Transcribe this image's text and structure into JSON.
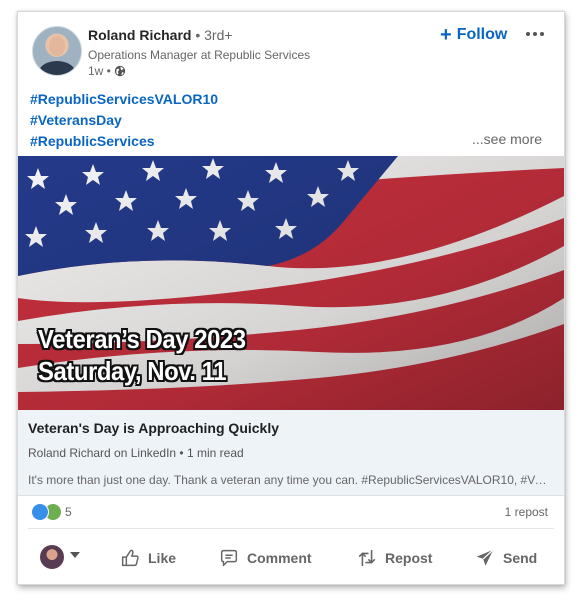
{
  "post": {
    "author": {
      "name": "Roland Richard",
      "degree": "• 3rd+",
      "headline": "Operations Manager at Republic Services",
      "time": "1w •"
    },
    "follow_label": "Follow",
    "hashtags": [
      "#RepublicServicesVALOR10",
      "#VeteransDay",
      "#RepublicServices"
    ],
    "see_more": "...see more",
    "image": {
      "line1": "Veteran’s Day 2023",
      "line2": "Saturday, Nov. 11"
    },
    "article": {
      "title": "Veteran's Day is Approaching Quickly",
      "subtitle": "Roland Richard on LinkedIn • 1 min read",
      "description": "It's more than just one day. Thank a veteran any time you can. #RepublicServicesVALOR10, #Vet..."
    },
    "reactions_count": "5",
    "reposts": "1 repost"
  },
  "actions": {
    "like": "Like",
    "comment": "Comment",
    "repost": "Repost",
    "send": "Send"
  },
  "colors": {
    "link_blue": "#0a66c2",
    "article_bg": "#eef3f8",
    "flag_red": "#c8303e",
    "flag_blue": "#243a8a"
  },
  "icons": [
    "globe-icon",
    "more-icon",
    "like-icon",
    "comment-icon",
    "repost-icon",
    "send-icon",
    "chevron-down-icon"
  ]
}
